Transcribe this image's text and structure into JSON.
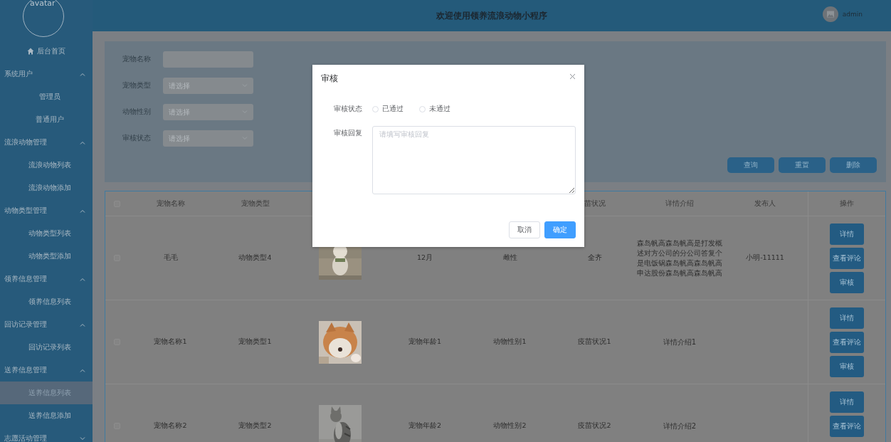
{
  "header": {
    "title": "欢迎使用领养流浪动物小程序",
    "user": "admin"
  },
  "sidebar": {
    "avatar_label": "avatar",
    "items": [
      {
        "label": "后台首页",
        "kind": "home"
      },
      {
        "label": "系统用户",
        "kind": "group",
        "expanded": true,
        "children": [
          {
            "label": "管理员",
            "selected": false
          },
          {
            "label": "普通用户",
            "selected": false
          }
        ]
      },
      {
        "label": "流浪动物管理",
        "kind": "group",
        "expanded": true,
        "children": [
          {
            "label": "流浪动物列表",
            "selected": false
          },
          {
            "label": "流浪动物添加",
            "selected": false
          }
        ]
      },
      {
        "label": "动物类型管理",
        "kind": "group",
        "expanded": true,
        "children": [
          {
            "label": "动物类型列表",
            "selected": false
          },
          {
            "label": "动物类型添加",
            "selected": false
          }
        ]
      },
      {
        "label": "领养信息管理",
        "kind": "group",
        "expanded": true,
        "children": [
          {
            "label": "领养信息列表",
            "selected": false
          }
        ]
      },
      {
        "label": "回访记录管理",
        "kind": "group",
        "expanded": true,
        "children": [
          {
            "label": "回访记录列表",
            "selected": false
          }
        ]
      },
      {
        "label": "送养信息管理",
        "kind": "group",
        "expanded": true,
        "children": [
          {
            "label": "送养信息列表",
            "selected": true
          },
          {
            "label": "送养信息添加",
            "selected": false
          }
        ]
      },
      {
        "label": "志愿活动管理",
        "kind": "group",
        "expanded": false
      }
    ]
  },
  "filters": [
    {
      "label": "宠物名称",
      "kind": "input"
    },
    {
      "label": "宠物类型",
      "kind": "select",
      "placeholder": "请选择"
    },
    {
      "label": "动物性别",
      "kind": "select",
      "placeholder": "请选择"
    },
    {
      "label": "审核状态",
      "kind": "select",
      "placeholder": "请选择"
    }
  ],
  "actions": [
    "查询",
    "重置",
    "删除"
  ],
  "table": {
    "header_checked": false,
    "columns": [
      {
        "label": "宠物名称"
      },
      {
        "label": "宠物类型"
      },
      {},
      {},
      {},
      {
        "label": "苗状况"
      },
      {
        "label": "详情介绍"
      },
      {
        "label": "发布人"
      },
      {
        "label": "操作"
      }
    ],
    "rows": [
      {
        "checked": false,
        "name": "毛毛",
        "type": "动物类型4",
        "picture": {
          "kind": "picture"
        },
        "age": "12月",
        "sex": "雌性",
        "vaccine": "全齐",
        "details": "森岛帆高森岛帆高是打发概述对方公司的分公司答复个是电饭锅森岛帆高森岛帆高申达股份森岛帆高森岛帆高",
        "publisher": "小明-11111",
        "buttons": [
          "详情",
          "查看评论",
          "审核"
        ]
      },
      {
        "checked": false,
        "name": "宠物名称1",
        "type": "宠物类型1",
        "picture": {
          "kind": "picture"
        },
        "age": "宠物年龄1",
        "sex": "动物性别1",
        "vaccine": "疫苗状况1",
        "details": "详情介绍1",
        "buttons": [
          "详情",
          "查看评论",
          "审核"
        ]
      },
      {
        "checked": false,
        "name": "宠物名称2",
        "type": "宠物类型2",
        "picture": {
          "kind": "picture"
        },
        "age": "宠物年龄2",
        "sex": "动物性别2",
        "vaccine": "疫苗状况2",
        "details": "详情介绍2",
        "buttons": [
          "详情",
          "查看评论"
        ]
      }
    ]
  },
  "dialog": {
    "title": "审核",
    "fields": [
      {
        "label": "审核状态",
        "kind": "radio",
        "options": [
          {
            "label": "已通过",
            "selected": false
          },
          {
            "label": "未通过",
            "selected": false
          }
        ]
      },
      {
        "label": "审核回复",
        "kind": "textarea",
        "placeholder": "请填写审核回复"
      }
    ],
    "buttons": [
      {
        "label": "取消",
        "kind": "secondary"
      },
      {
        "label": "确定",
        "kind": "primary"
      }
    ]
  }
}
